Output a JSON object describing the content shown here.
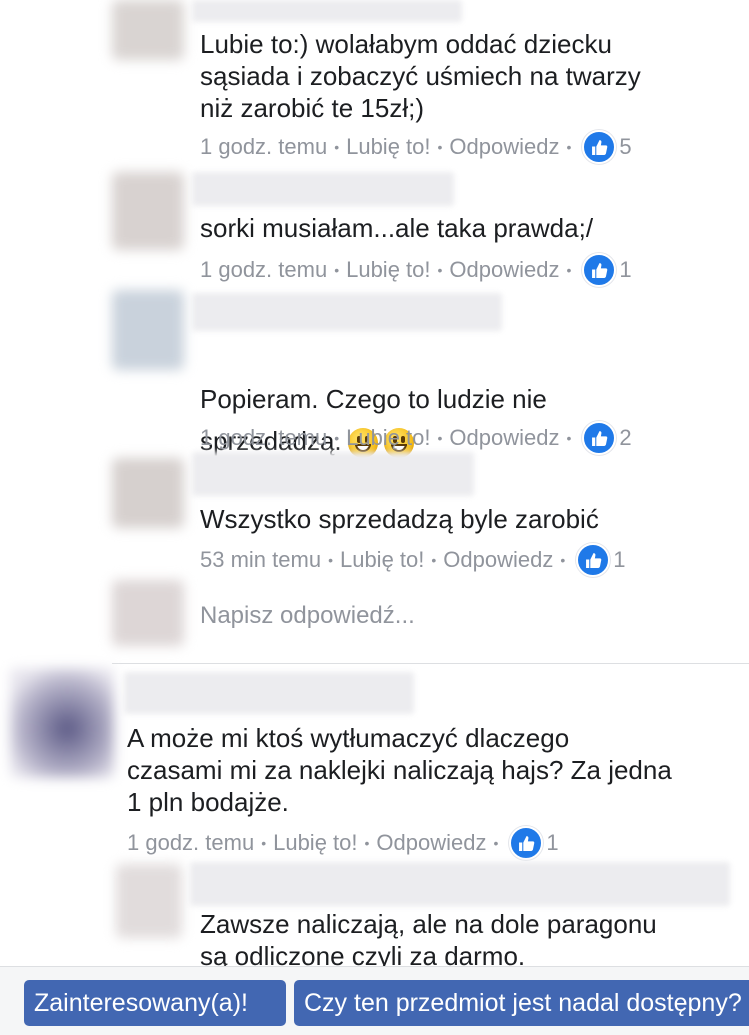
{
  "comments": [
    {
      "text": "Lubie to:) wolałabym oddać dziecku\nsąsiada i zobaczyć uśmiech na twarzy\nniż zarobić te 15zł;)",
      "time": "1 godz. temu",
      "like": "Lubię to!",
      "reply": "Odpowiedz",
      "likes": "5"
    },
    {
      "text": "sorki musiałam...ale taka prawda;/",
      "time": "1 godz. temu",
      "like": "Lubię to!",
      "reply": "Odpowiedz",
      "likes": "1"
    },
    {
      "text": "Popieram. Czego to ludzie nie\nsprzedadzą.",
      "time": "1 godz. temu",
      "like": "Lubię to!",
      "reply": "Odpowiedz",
      "likes": "2"
    },
    {
      "text": "Wszystko sprzedadzą byle zarobić",
      "time": "53 min temu",
      "like": "Lubię to!",
      "reply": "Odpowiedz",
      "likes": "1"
    },
    {
      "text": "A może mi ktoś wytłumaczyć dlaczego\nczasami mi za naklejki naliczają hajs? Za jedna\n1 pln bodajże.",
      "time": "1 godz. temu",
      "like": "Lubię to!",
      "reply": "Odpowiedz",
      "likes": "1"
    },
    {
      "text": "Zawsze naliczają, ale na dole paragonu\nsą odliczone czyli za darmo."
    }
  ],
  "reply_placeholder": "Napisz odpowiedź...",
  "quick_replies": [
    "Zainteresowany(a)!",
    "Czy ten przedmiot jest nadal dostępny?"
  ],
  "colors": {
    "accent": "#4267b2",
    "like_blue": "#1f79e8",
    "meta_gray": "#90949c"
  },
  "icons": {
    "like": "thumbs-up-icon",
    "emoji": "grinning-face-icon"
  }
}
